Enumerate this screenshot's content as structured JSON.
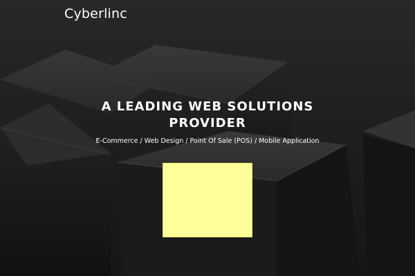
{
  "header": {
    "logo_text": "Cyberlinc"
  },
  "hero": {
    "headline": "A LEADING WEB SOLUTIONS PROVIDER",
    "subtitle": "E-Commerce / Web Design / Point Of Sale (POS) / Mobile Application"
  },
  "colors": {
    "background": "#1f1f1f",
    "media_placeholder": "#ffff99",
    "text": "#ffffff"
  }
}
